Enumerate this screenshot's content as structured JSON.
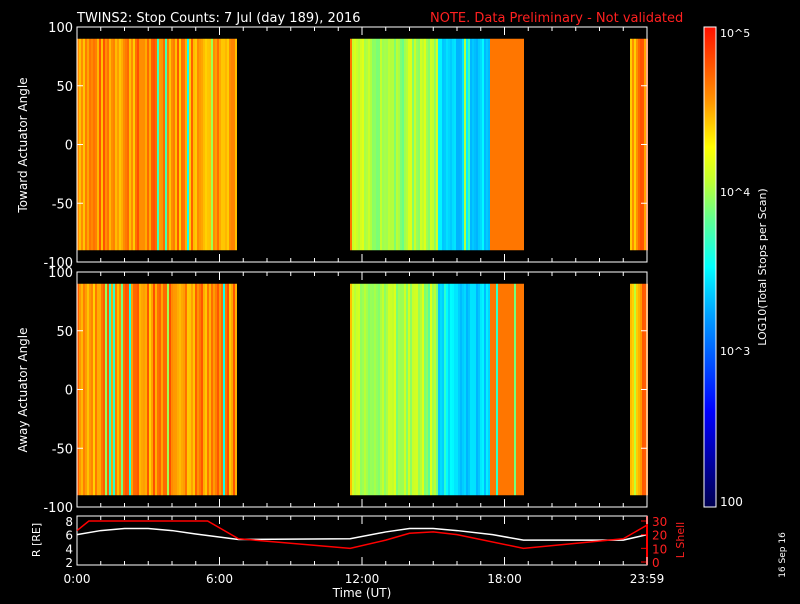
{
  "header": {
    "title": "TWINS2: Stop Counts:  7 Jul (day 189), 2016",
    "note": "NOTE. Data Preliminary - Not validated"
  },
  "panels": [
    {
      "ylabel": "Toward Actuator Angle"
    },
    {
      "ylabel": "Away Actuator Angle"
    }
  ],
  "angle_ticks": [
    "100",
    "50",
    "0",
    "-50",
    "-100"
  ],
  "colorbar": {
    "label": "LOG10(Total Stops per Scan)",
    "ticks": [
      "10^5",
      "10^4",
      "10^3",
      "100"
    ]
  },
  "orbit": {
    "r_label": "R [RE]",
    "r_ticks": [
      "8",
      "6",
      "4",
      "2"
    ],
    "l_label": "L Shell",
    "l_ticks": [
      "30",
      "20",
      "10",
      "0"
    ]
  },
  "x_ticks": [
    "0:00",
    "6:00",
    "12:00",
    "18:00",
    "23:59"
  ],
  "xlabel": "Time (UT)",
  "stamp": "16 Sep 16",
  "chart_data": {
    "type": "heatmap",
    "title": "TWINS2: Stop Counts:  7 Jul (day 189), 2016",
    "xlim_hours": [
      0,
      24
    ],
    "ylim": [
      -100,
      100
    ],
    "data_intervals_hours": [
      [
        0,
        6.7
      ],
      [
        11.5,
        18.8
      ],
      [
        23.3,
        24
      ]
    ],
    "angle_range": [
      -90,
      90
    ],
    "color_range_log10": [
      2,
      5
    ],
    "orbit_series": [
      {
        "name": "R",
        "color": "#ffffff",
        "axis": "R",
        "ylim": [
          2,
          8
        ],
        "x": [
          0,
          1,
          2,
          3,
          4,
          5,
          6.8,
          11.5,
          13,
          14,
          15,
          16,
          17.5,
          18.8,
          23,
          24
        ],
        "y": [
          6.0,
          6.6,
          6.9,
          6.9,
          6.6,
          6.1,
          5.3,
          5.4,
          6.4,
          6.9,
          6.9,
          6.6,
          6.0,
          5.2,
          5.2,
          6.0
        ]
      },
      {
        "name": "L Shell",
        "color": "#ff0000",
        "axis": "L",
        "ylim": [
          0,
          30
        ],
        "x": [
          0,
          0.5,
          5.5,
          6.8,
          11.5,
          13,
          14,
          15,
          16,
          18.8,
          23,
          24
        ],
        "y": [
          23,
          30,
          30,
          17,
          10,
          16,
          21,
          22,
          20,
          10,
          17,
          27
        ]
      }
    ]
  }
}
